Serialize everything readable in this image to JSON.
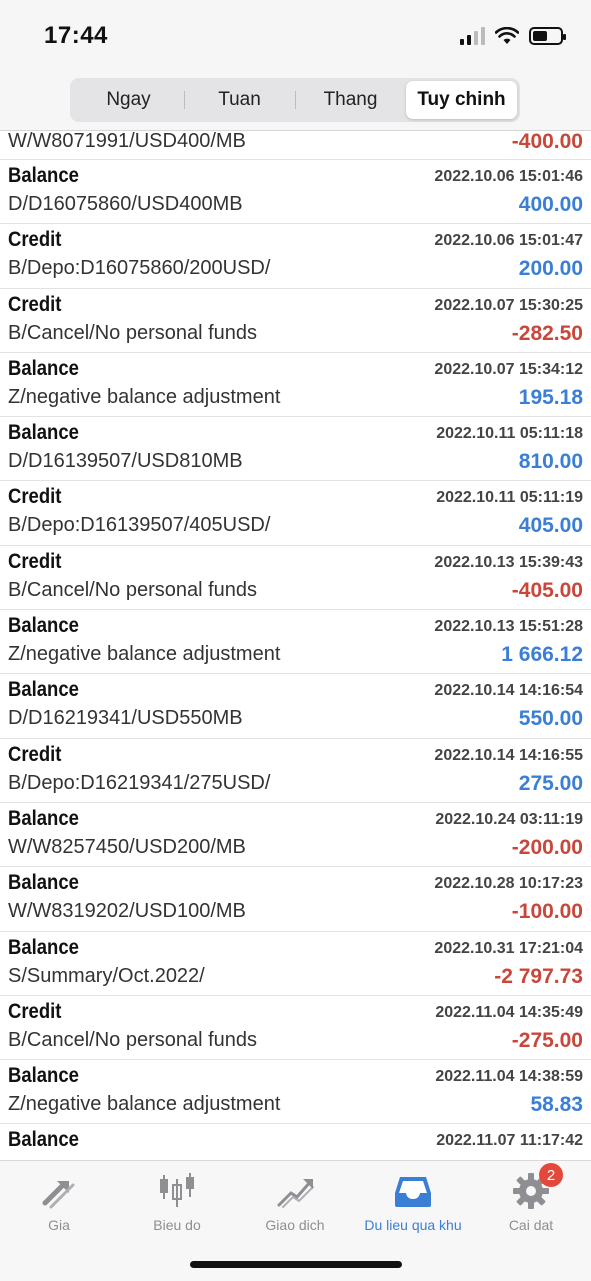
{
  "status_bar": {
    "time": "17:44"
  },
  "tabs": [
    {
      "label": "Ngay",
      "active": false
    },
    {
      "label": "Tuan",
      "active": false
    },
    {
      "label": "Thang",
      "active": false
    },
    {
      "label": "Tuy chinh",
      "active": true
    }
  ],
  "history": {
    "partial_top": {
      "comment": "W/W8071991/USD400/MB",
      "amount": "-400.00",
      "sign": "neg"
    },
    "rows": [
      {
        "type": "Balance",
        "time": "2022.10.06 15:01:46",
        "comment": "D/D16075860/USD400MB",
        "amount": "400.00",
        "sign": "pos"
      },
      {
        "type": "Credit",
        "time": "2022.10.06 15:01:47",
        "comment": "B/Depo:D16075860/200USD/",
        "amount": "200.00",
        "sign": "pos"
      },
      {
        "type": "Credit",
        "time": "2022.10.07 15:30:25",
        "comment": "B/Cancel/No personal funds",
        "amount": "-282.50",
        "sign": "neg"
      },
      {
        "type": "Balance",
        "time": "2022.10.07 15:34:12",
        "comment": "Z/negative balance adjustment",
        "amount": "195.18",
        "sign": "pos"
      },
      {
        "type": "Balance",
        "time": "2022.10.11 05:11:18",
        "comment": "D/D16139507/USD810MB",
        "amount": "810.00",
        "sign": "pos"
      },
      {
        "type": "Credit",
        "time": "2022.10.11 05:11:19",
        "comment": "B/Depo:D16139507/405USD/",
        "amount": "405.00",
        "sign": "pos"
      },
      {
        "type": "Credit",
        "time": "2022.10.13 15:39:43",
        "comment": "B/Cancel/No personal funds",
        "amount": "-405.00",
        "sign": "neg"
      },
      {
        "type": "Balance",
        "time": "2022.10.13 15:51:28",
        "comment": "Z/negative balance adjustment",
        "amount": "1 666.12",
        "sign": "pos"
      },
      {
        "type": "Balance",
        "time": "2022.10.14 14:16:54",
        "comment": "D/D16219341/USD550MB",
        "amount": "550.00",
        "sign": "pos"
      },
      {
        "type": "Credit",
        "time": "2022.10.14 14:16:55",
        "comment": "B/Depo:D16219341/275USD/",
        "amount": "275.00",
        "sign": "pos"
      },
      {
        "type": "Balance",
        "time": "2022.10.24 03:11:19",
        "comment": "W/W8257450/USD200/MB",
        "amount": "-200.00",
        "sign": "neg"
      },
      {
        "type": "Balance",
        "time": "2022.10.28 10:17:23",
        "comment": "W/W8319202/USD100/MB",
        "amount": "-100.00",
        "sign": "neg"
      },
      {
        "type": "Balance",
        "time": "2022.10.31 17:21:04",
        "comment": "S/Summary/Oct.2022/",
        "amount": "-2 797.73",
        "sign": "neg"
      },
      {
        "type": "Credit",
        "time": "2022.11.04 14:35:49",
        "comment": "B/Cancel/No personal funds",
        "amount": "-275.00",
        "sign": "neg"
      },
      {
        "type": "Balance",
        "time": "2022.11.04 14:38:59",
        "comment": "Z/negative balance adjustment",
        "amount": "58.83",
        "sign": "pos"
      },
      {
        "type": "Balance",
        "time": "2022.11.07 11:17:42",
        "comment": "",
        "amount": "",
        "sign": "pos"
      }
    ]
  },
  "bottom_nav": [
    {
      "label": "Gia",
      "icon": "arrows-icon",
      "active": false
    },
    {
      "label": "Bieu do",
      "icon": "candlestick-icon",
      "active": false
    },
    {
      "label": "Giao dich",
      "icon": "trend-icon",
      "active": false
    },
    {
      "label": "Du lieu qua khu",
      "icon": "inbox-icon",
      "active": true
    },
    {
      "label": "Cai dat",
      "icon": "gear-icon",
      "active": false,
      "badge": "2"
    }
  ],
  "colors": {
    "negative": "#c9473a",
    "positive": "#3a7fd5",
    "accent": "#3a7fd5",
    "badge": "#e5483b"
  }
}
